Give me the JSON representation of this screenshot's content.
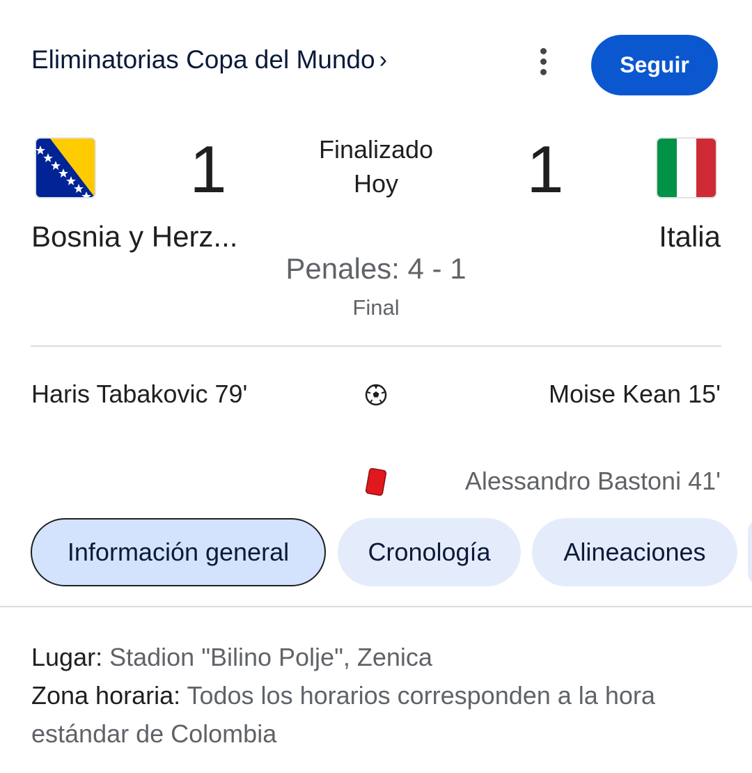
{
  "header": {
    "competition": "Eliminatorias Copa del Mundo",
    "chevron": "›",
    "more_icon": "more-vert-icon",
    "follow_label": "Seguir"
  },
  "match": {
    "home": {
      "name": "Bosnia y Herz...",
      "score": "1",
      "flag_icon": "flag-bosnia-icon"
    },
    "away": {
      "name": "Italia",
      "score": "1",
      "flag_icon": "flag-italy-icon"
    },
    "status": "Finalizado",
    "day": "Hoy",
    "penalties": "Penales: 4 - 1",
    "result_label": "Final"
  },
  "events": {
    "goals": {
      "home": "Haris Tabakovic 79'",
      "away": "Moise Kean 15'",
      "icon": "soccer-ball-icon"
    },
    "red_cards": {
      "home": "",
      "away": "Alessandro Bastoni 41'",
      "icon": "red-card-icon"
    }
  },
  "tabs": [
    {
      "label": "Información general",
      "selected": true
    },
    {
      "label": "Cronología",
      "selected": false
    },
    {
      "label": "Alineaciones",
      "selected": false
    }
  ],
  "info": {
    "venue_label": "Lugar:",
    "venue_value": "Stadion \"Bilino Polje\", Zenica",
    "tz_label": "Zona horaria:",
    "tz_value": "Todos los horarios corresponden a la hora estándar de Colombia"
  },
  "colors": {
    "accent": "#0b57d0",
    "tab_selected": "#d3e3fd",
    "tab_default": "#e4ecfc",
    "red_card": "#e0191f"
  }
}
